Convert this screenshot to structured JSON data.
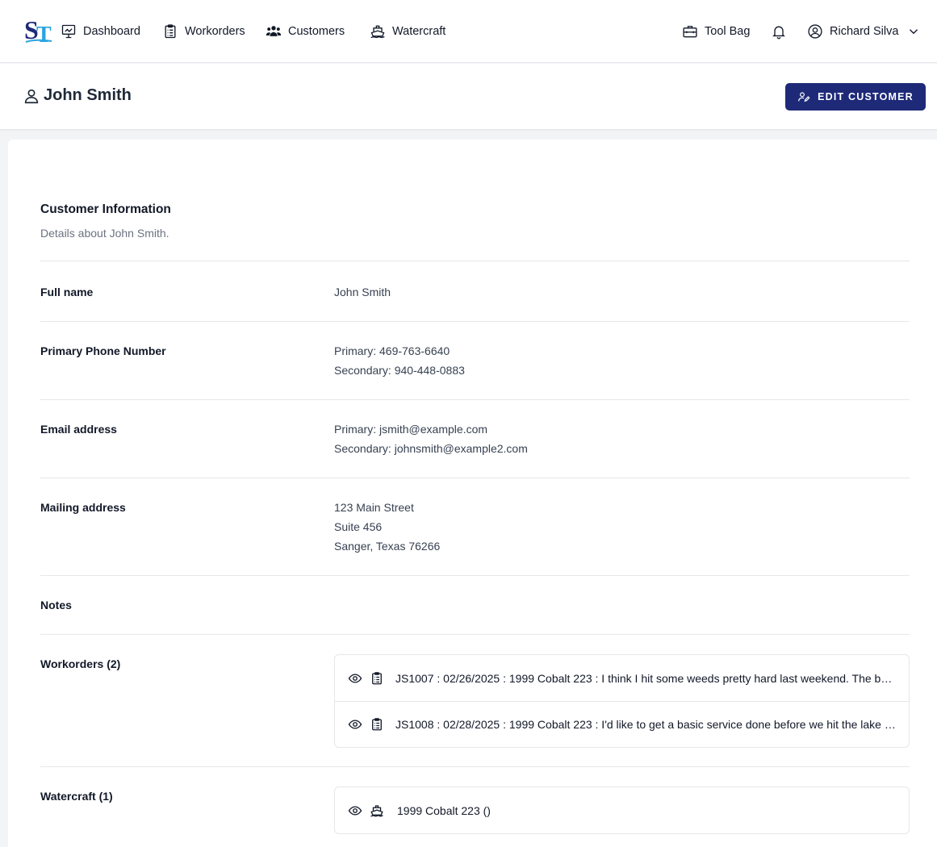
{
  "nav": {
    "logo_text": "ST",
    "items": [
      {
        "label": "Dashboard",
        "icon": "chart-monitor-icon"
      },
      {
        "label": "Workorders",
        "icon": "clipboard-icon"
      },
      {
        "label": "Customers",
        "icon": "users-icon"
      },
      {
        "label": "Watercraft",
        "icon": "boat-icon"
      }
    ],
    "toolbag_label": "Tool Bag",
    "user_name": "Richard Silva"
  },
  "header": {
    "title": "John Smith",
    "edit_button": "EDIT CUSTOMER"
  },
  "info": {
    "title": "Customer Information",
    "subtitle": "Details about John Smith.",
    "full_name_label": "Full name",
    "full_name": "John Smith",
    "phone_label": "Primary Phone Number",
    "phone_primary": "Primary: 469-763-6640",
    "phone_secondary": "Secondary: 940-448-0883",
    "email_label": "Email address",
    "email_primary": "Primary: jsmith@example.com",
    "email_secondary": "Secondary: johnsmith@example2.com",
    "address_label": "Mailing address",
    "address_line1": "123 Main Street",
    "address_line2": "Suite 456",
    "address_line3": "Sanger, Texas 76266",
    "notes_label": "Notes"
  },
  "workorders": {
    "label": "Workorders (2)",
    "items": [
      "JS1007 : 02/26/2025 : 1999 Cobalt 223 : I think I hit some weeds pretty hard last weekend. The boat just doesn't feel right",
      "JS1008 : 02/28/2025 : 1999 Cobalt 223 : I'd like to get a basic service done before we hit the lake this season"
    ]
  },
  "watercraft": {
    "label": "Watercraft (1)",
    "items": [
      "1999 Cobalt 223 ()"
    ]
  },
  "colors": {
    "accent": "#1e2a78",
    "logo_s": "#1e2a78",
    "logo_t": "#29a3e0"
  }
}
